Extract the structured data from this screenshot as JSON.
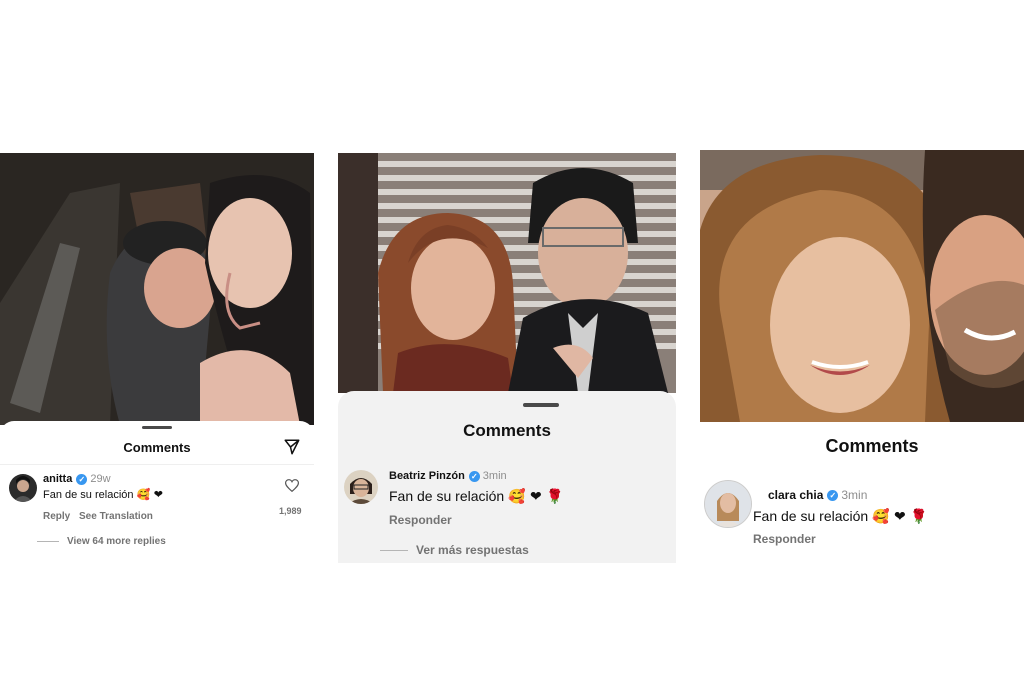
{
  "panels": [
    {
      "comments_title": "Comments",
      "username": "anitta",
      "time": "29w",
      "comment": "Fan de su relación",
      "emojis": "🥰 ❤",
      "reply_label": "Reply",
      "translation_label": "See Translation",
      "like_count": "1,989",
      "view_replies": "View 64 more replies"
    },
    {
      "comments_title": "Comments",
      "username": "Beatriz Pinzón",
      "time": "3min",
      "comment": "Fan de su relación",
      "emojis": "🥰 ❤ 🌹",
      "reply_label": "Responder",
      "view_replies": "Ver más respuestas"
    },
    {
      "comments_title": "Comments",
      "username": "clara chia",
      "time": "3min",
      "comment": "Fan de su relación",
      "emojis": "🥰 ❤ 🌹",
      "reply_label": "Responder"
    }
  ],
  "colors": {
    "verified": "#3897f0",
    "muted": "#737373",
    "sheet": "#ffffff"
  }
}
